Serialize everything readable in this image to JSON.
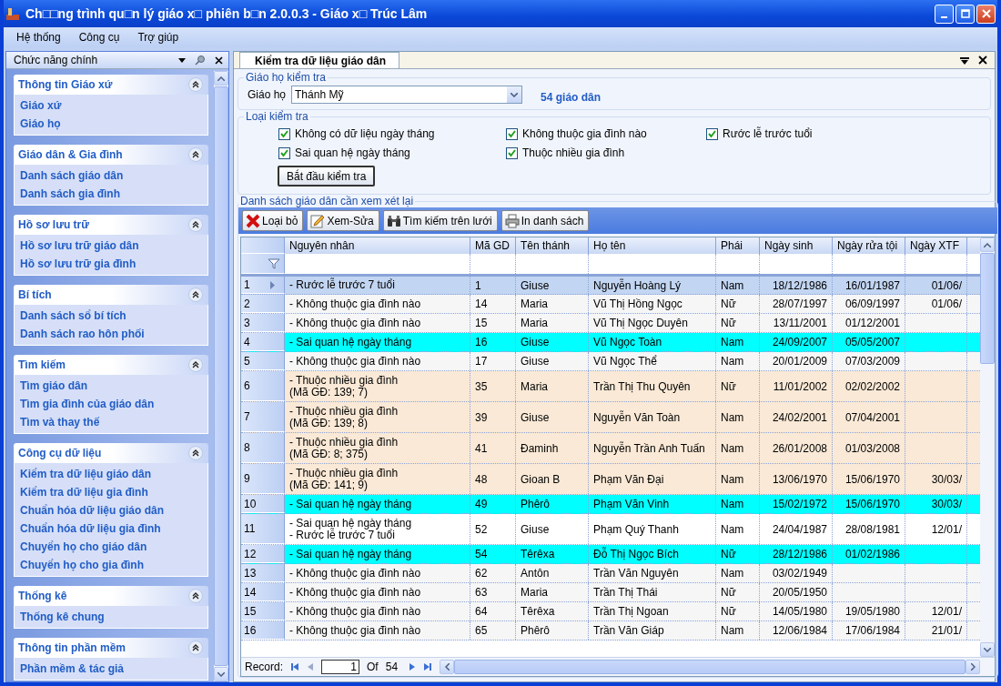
{
  "window": {
    "title": "Ch□□ng trình qu□n lý giáo x□ phiên b□n 2.0.0.3 - Giáo x□ Trúc Lâm"
  },
  "menu": [
    "Hệ thống",
    "Công cụ",
    "Trợ giúp"
  ],
  "sidebar": {
    "title": "Chức năng chính",
    "groups": [
      {
        "title": "Thông tin Giáo xứ",
        "expanded": true,
        "items": [
          "Giáo xứ",
          "Giáo họ"
        ]
      },
      {
        "title": "Giáo dân & Gia đình",
        "expanded": true,
        "items": [
          "Danh sách giáo dân",
          "Danh sách gia đình"
        ]
      },
      {
        "title": "Hồ sơ lưu trữ",
        "expanded": true,
        "items": [
          "Hồ sơ lưu trữ giáo dân",
          "Hồ sơ lưu trữ gia đình"
        ]
      },
      {
        "title": "Bí tích",
        "expanded": true,
        "items": [
          "Danh sách sổ bí tích",
          "Danh sách rao hôn phối"
        ]
      },
      {
        "title": "Tìm kiếm",
        "expanded": true,
        "items": [
          "Tìm giáo dân",
          "Tìm gia đình của giáo dân",
          "Tìm và thay thế"
        ]
      },
      {
        "title": "Công cụ dữ liệu",
        "expanded": true,
        "items": [
          "Kiểm tra dữ liệu giáo dân",
          "Kiểm tra dữ liệu gia đình",
          "Chuẩn hóa dữ liệu giáo dân",
          "Chuẩn hóa dữ liệu gia đình",
          "Chuyển họ cho giáo dân",
          "Chuyển họ cho gia đình"
        ]
      },
      {
        "title": "Thống kê",
        "expanded": true,
        "items": [
          "Thống kê chung"
        ]
      },
      {
        "title": "Thông tin phần mềm",
        "expanded": true,
        "items": [
          "Phần mềm & tác giả"
        ]
      }
    ]
  },
  "tab": {
    "label": "Kiểm tra dữ liệu giáo dân"
  },
  "parish_box": {
    "legend": "Giáo họ kiểm tra",
    "label": "Giáo họ",
    "value": "Thánh Mỹ",
    "count": "54 giáo dân"
  },
  "check_box": {
    "legend": "Loại kiểm tra",
    "options": [
      {
        "label": "Không có dữ liệu ngày tháng",
        "checked": true
      },
      {
        "label": "Không thuộc gia đình nào",
        "checked": true
      },
      {
        "label": "Rước lễ trước tuổi",
        "checked": true
      },
      {
        "label": "Sai quan hệ ngày tháng",
        "checked": true
      },
      {
        "label": "Thuộc nhiều gia đình",
        "checked": true
      }
    ],
    "button": "Bắt đầu kiểm tra"
  },
  "results": {
    "legend": "Danh sách giáo dân cần xem xét lại",
    "toolbar": [
      {
        "label": "Loại bỏ",
        "kind": "remove"
      },
      {
        "label": "Xem-Sửa",
        "kind": "edit"
      },
      {
        "label": "Tìm kiếm trên lưới",
        "kind": "search"
      },
      {
        "label": "In danh sách",
        "kind": "print"
      }
    ],
    "columns": [
      "Nguyên nhân",
      "Mã GD",
      "Tên thánh",
      "Họ tên",
      "Phái",
      "Ngày sinh",
      "Ngày rửa tội",
      "Ngày XTF"
    ],
    "rows": [
      {
        "no": "1",
        "selected": true,
        "kind": "other",
        "cells": [
          "- Rước lễ trước 7 tuổi",
          "1",
          "Giuse",
          "Nguyễn Hoàng Lý",
          "Nam",
          "18/12/1986",
          "16/01/1987",
          "01/06/"
        ]
      },
      {
        "no": "2",
        "selected": false,
        "kind": "other",
        "cells": [
          "- Không thuộc gia đình nào",
          "14",
          "Maria",
          "Vũ Thị Hồng Ngọc",
          "Nữ",
          "28/07/1997",
          "06/09/1997",
          "01/06/"
        ]
      },
      {
        "no": "3",
        "selected": false,
        "kind": "other",
        "cells": [
          "- Không thuộc gia đình nào",
          "15",
          "Maria",
          "Vũ Thị Ngọc Duyên",
          "Nữ",
          "13/11/2001",
          "01/12/2001",
          null
        ]
      },
      {
        "no": "4",
        "selected": false,
        "kind": "date",
        "cells": [
          "- Sai quan hệ ngày tháng",
          "16",
          "Giuse",
          "Vũ Ngọc Toàn",
          "Nam",
          "24/09/2007",
          "05/05/2007",
          null
        ]
      },
      {
        "no": "5",
        "selected": false,
        "kind": "other",
        "cells": [
          "- Không thuộc gia đình nào",
          "17",
          "Giuse",
          "Vũ Ngọc Thể",
          "Nam",
          "20/01/2009",
          "07/03/2009",
          null
        ]
      },
      {
        "no": "6",
        "selected": false,
        "kind": "family",
        "cells": [
          "- Thuộc nhiều gia đình\n (Mã GĐ: 139; 7)",
          "35",
          "Maria",
          "Trần Thị Thu Quyên",
          "Nữ",
          "11/01/2002",
          "02/02/2002",
          null
        ]
      },
      {
        "no": "7",
        "selected": false,
        "kind": "family",
        "cells": [
          "- Thuộc nhiều gia đình\n (Mã GĐ: 139; 8)",
          "39",
          "Giuse",
          "Nguyễn Văn Toàn",
          "Nam",
          "24/02/2001",
          "07/04/2001",
          null
        ]
      },
      {
        "no": "8",
        "selected": false,
        "kind": "family",
        "cells": [
          "- Thuộc nhiều gia đình\n (Mã GĐ: 8; 375)",
          "41",
          "Đaminh",
          "Nguyễn Trần Anh Tuấn",
          "Nam",
          "26/01/2008",
          "01/03/2008",
          null
        ]
      },
      {
        "no": "9",
        "selected": false,
        "kind": "family",
        "cells": [
          "- Thuộc nhiều gia đình\n (Mã GĐ: 141; 9)",
          "48",
          "Gioan B",
          "Phạm Văn Đại",
          "Nam",
          "13/06/1970",
          "15/06/1970",
          "30/03/"
        ]
      },
      {
        "no": "10",
        "selected": false,
        "kind": "date",
        "cells": [
          "- Sai quan hệ ngày tháng",
          "49",
          "Phêrô",
          "Phạm Văn Vinh",
          "Nam",
          "15/02/1972",
          "15/06/1970",
          "30/03/"
        ]
      },
      {
        "no": "11",
        "selected": false,
        "kind": "mixed",
        "cells": [
          "- Sai quan hệ ngày tháng\n- Rước lễ trước 7 tuổi",
          "52",
          "Giuse",
          "Phạm Quý Thanh",
          "Nam",
          "24/04/1987",
          "28/08/1981",
          "12/01/"
        ]
      },
      {
        "no": "12",
        "selected": false,
        "kind": "date",
        "cells": [
          "- Sai quan hệ ngày tháng",
          "54",
          "Têrêxa",
          "Đỗ Thị Ngọc Bích",
          "Nữ",
          "28/12/1986",
          "01/02/1986",
          null
        ]
      },
      {
        "no": "13",
        "selected": false,
        "kind": "other",
        "cells": [
          "- Không thuộc gia đình nào",
          "62",
          "Antôn",
          "Trần Văn Nguyên",
          "Nam",
          "03/02/1949",
          null,
          null
        ]
      },
      {
        "no": "14",
        "selected": false,
        "kind": "other",
        "cells": [
          "- Không thuộc gia đình nào",
          "63",
          "Maria",
          "Trần Thị Thái",
          "Nữ",
          "20/05/1950",
          null,
          null
        ]
      },
      {
        "no": "15",
        "selected": false,
        "kind": "other",
        "cells": [
          "- Không thuộc gia đình nào",
          "64",
          "Têrêxa",
          "Trần Thị Ngoan",
          "Nữ",
          "14/05/1980",
          "19/05/1980",
          "12/01/"
        ]
      },
      {
        "no": "16",
        "selected": false,
        "kind": "other",
        "cells": [
          "- Không thuộc gia đình nào",
          "65",
          "Phêrô",
          "Trần Văn Giáp",
          "Nam",
          "12/06/1984",
          "17/06/1984",
          "21/01/"
        ]
      }
    ],
    "pager": {
      "label": "Record:",
      "value": "1",
      "of": "Of",
      "total": "54"
    }
  }
}
